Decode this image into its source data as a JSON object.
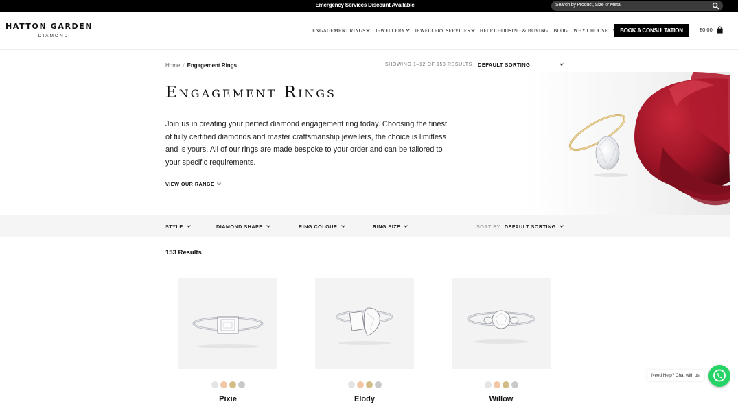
{
  "topbar": {
    "message": "Emergency Services Discount Available",
    "search_placeholder": "Search by Product, Size or Metal",
    "search_icon": "search-icon"
  },
  "header": {
    "logo_main": "HATTON GARDEN",
    "logo_sub": "DIAMOND",
    "nav": [
      {
        "label": "Engagement Rings",
        "dropdown": true
      },
      {
        "label": "Jewellery",
        "dropdown": true
      },
      {
        "label": "Jewellery Services",
        "dropdown": true
      },
      {
        "label": "Help Choosing & Buying",
        "dropdown": false
      },
      {
        "label": "Blog",
        "dropdown": false
      },
      {
        "label": "Why Choose Us?",
        "dropdown": false
      }
    ],
    "cta": "BOOK A CONSULTATION",
    "cart_total": "£0.00",
    "cart_icon": "bag-icon"
  },
  "hero": {
    "breadcrumb": [
      "Home",
      "Engagement Rings"
    ],
    "showing": "Showing 1–12 of 153 results",
    "sort": "Default sorting",
    "title": "Engagement Rings",
    "intro": "Join us in creating your perfect diamond engagement ring today. Choosing the finest of fully certified diamonds and master craftsmanship jewellers, the choice is limitless and is yours. All of our rings are made bespoke to your order and can be tailored to your specific requirements.",
    "view_range": "View our range"
  },
  "filters": {
    "items": [
      "Style",
      "Diamond Shape",
      "Ring Colour",
      "Ring Size"
    ],
    "sort_label": "Sort by:",
    "sort_value": "Default sorting"
  },
  "results": "153 Results",
  "products": [
    {
      "name": "Pixie",
      "cut": "emerald"
    },
    {
      "name": "Elody",
      "cut": "toi-et-moi"
    },
    {
      "name": "Willow",
      "cut": "round-trilogy"
    }
  ],
  "swatch_colors": [
    "#e4e4e4",
    "#f1c7a5",
    "#d3bd86",
    "#c9c9c9"
  ],
  "help": {
    "label": "Need Help? Chat with us",
    "icon": "whatsapp-icon",
    "color": "#25d366"
  }
}
